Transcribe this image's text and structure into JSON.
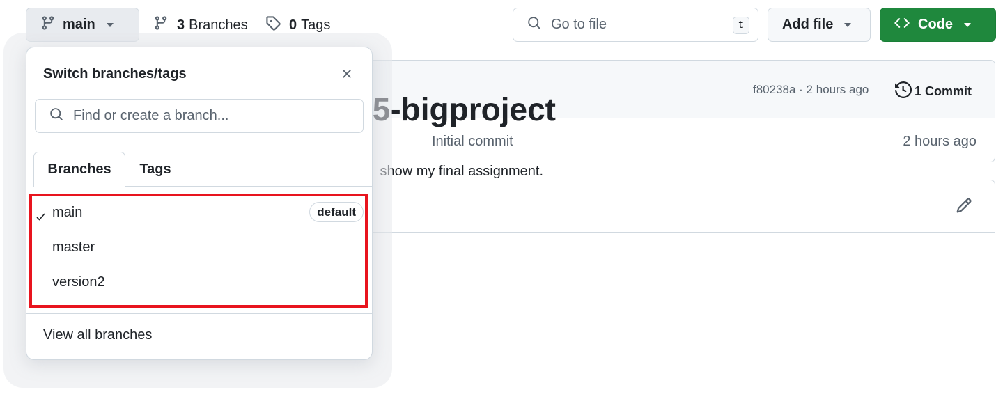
{
  "toolbar": {
    "branch_button_label": "main",
    "branches_count": "3",
    "branches_word": "Branches",
    "tags_count": "0",
    "tags_word": "Tags",
    "go_to_file_placeholder": "Go to file",
    "go_to_file_shortcut": "t",
    "add_file_label": "Add file",
    "code_label": "Code"
  },
  "latest_commit": {
    "hash_time": "f80238a · 2 hours ago",
    "commits_label": "1 Commit",
    "file_row_message": "Initial commit",
    "file_row_time": "2 hours ago"
  },
  "readme": {
    "title_visible": "5-bigproject",
    "text_visible": "show my final assignment."
  },
  "branch_dropdown": {
    "title": "Switch branches/tags",
    "search_placeholder": "Find or create a branch...",
    "tabs": [
      {
        "label": "Branches",
        "selected": true
      },
      {
        "label": "Tags",
        "selected": false
      }
    ],
    "branches": [
      {
        "name": "main",
        "checked": true,
        "badge": "default"
      },
      {
        "name": "master",
        "checked": false
      },
      {
        "name": "version2",
        "checked": false
      }
    ],
    "view_all_label": "View all branches"
  },
  "colors": {
    "code_button_bg": "#1f883d",
    "highlight_border": "#e8141e",
    "text_primary": "#1f2328",
    "text_muted": "#59636e"
  }
}
